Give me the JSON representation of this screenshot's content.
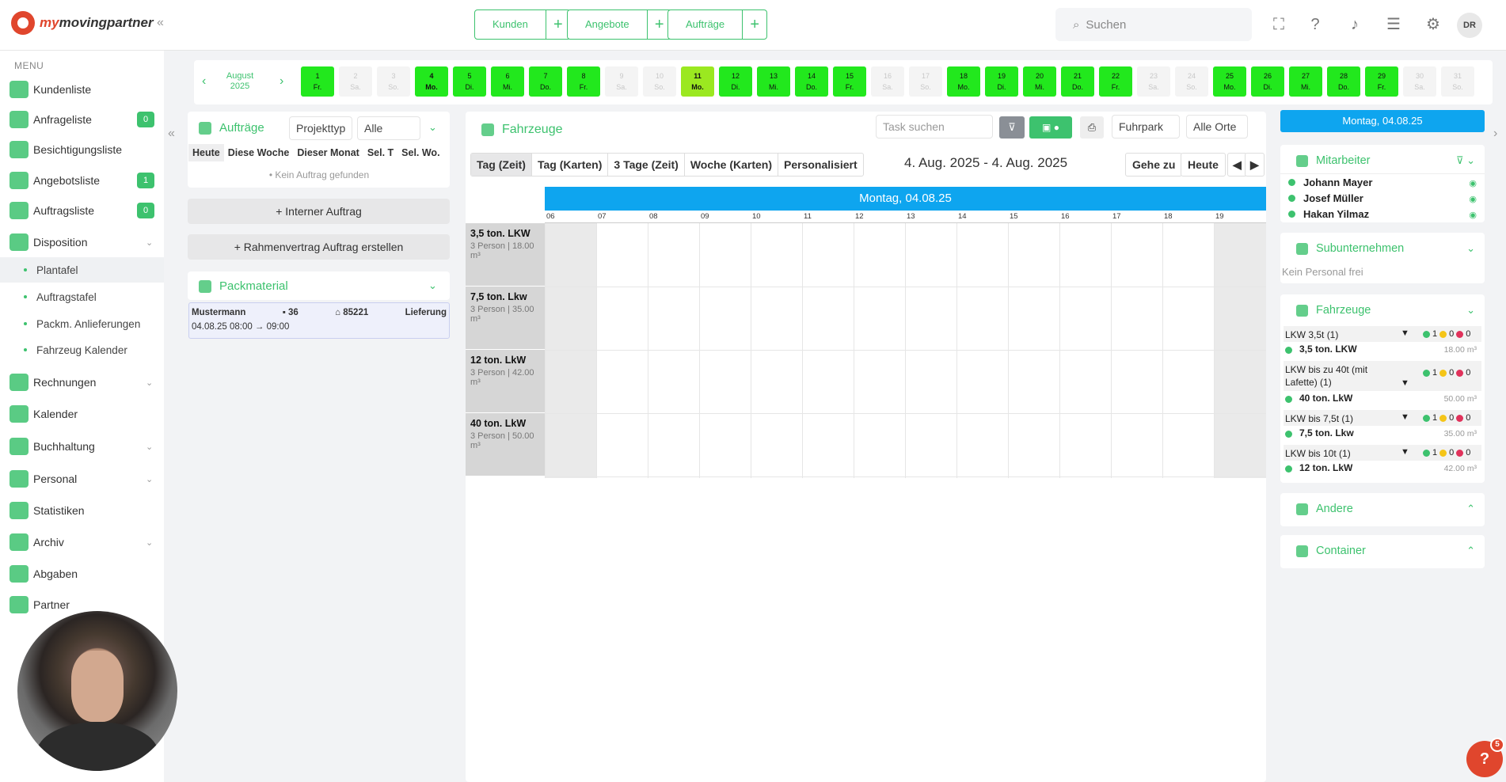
{
  "app": {
    "logo_text_1": "my",
    "logo_text_2": "movingpartner"
  },
  "topbar": {
    "quick": [
      {
        "label": "Kunden"
      },
      {
        "label": "Angebote"
      },
      {
        "label": "Aufträge"
      }
    ],
    "search_placeholder": "Suchen",
    "avatar": "DR"
  },
  "sidebar": {
    "menu_label": "MENU",
    "items": [
      {
        "label": "Kundenliste"
      },
      {
        "label": "Anfrageliste",
        "badge": "0"
      },
      {
        "label": "Besichtigungsliste"
      },
      {
        "label": "Angebotsliste",
        "badge": "1"
      },
      {
        "label": "Auftragsliste",
        "badge": "0"
      },
      {
        "label": "Disposition"
      },
      {
        "label": "Rechnungen"
      },
      {
        "label": "Kalender"
      },
      {
        "label": "Buchhaltung"
      },
      {
        "label": "Personal"
      },
      {
        "label": "Statistiken"
      },
      {
        "label": "Archiv"
      },
      {
        "label": "Abgaben"
      },
      {
        "label": "Partner"
      }
    ],
    "sub": [
      {
        "label": "Plantafel"
      },
      {
        "label": "Auftragstafel"
      },
      {
        "label": "Packm. Anlieferungen"
      },
      {
        "label": "Fahrzeug Kalender"
      }
    ]
  },
  "datebar": {
    "month": "August",
    "year": "2025",
    "days": [
      {
        "n": "1",
        "d": "Fr."
      },
      {
        "n": "2",
        "d": "Sa."
      },
      {
        "n": "3",
        "d": "So."
      },
      {
        "n": "4",
        "d": "Mo."
      },
      {
        "n": "5",
        "d": "Di."
      },
      {
        "n": "6",
        "d": "Mi."
      },
      {
        "n": "7",
        "d": "Do."
      },
      {
        "n": "8",
        "d": "Fr."
      },
      {
        "n": "9",
        "d": "Sa."
      },
      {
        "n": "10",
        "d": "So."
      },
      {
        "n": "11",
        "d": "Mo."
      },
      {
        "n": "12",
        "d": "Di."
      },
      {
        "n": "13",
        "d": "Mi."
      },
      {
        "n": "14",
        "d": "Do."
      },
      {
        "n": "15",
        "d": "Fr."
      },
      {
        "n": "16",
        "d": "Sa."
      },
      {
        "n": "17",
        "d": "So."
      },
      {
        "n": "18",
        "d": "Mo."
      },
      {
        "n": "19",
        "d": "Di."
      },
      {
        "n": "20",
        "d": "Mi."
      },
      {
        "n": "21",
        "d": "Do."
      },
      {
        "n": "22",
        "d": "Fr."
      },
      {
        "n": "23",
        "d": "Sa."
      },
      {
        "n": "24",
        "d": "So."
      },
      {
        "n": "25",
        "d": "Mo."
      },
      {
        "n": "26",
        "d": "Di."
      },
      {
        "n": "27",
        "d": "Mi."
      },
      {
        "n": "28",
        "d": "Do."
      },
      {
        "n": "29",
        "d": "Fr."
      },
      {
        "n": "30",
        "d": "Sa."
      },
      {
        "n": "31",
        "d": "So."
      }
    ]
  },
  "auftraege": {
    "title": "Aufträge",
    "projekttyp": "Projekttyp",
    "filter": "Alle",
    "tabs": [
      "Heute",
      "Diese Woche",
      "Dieser Monat",
      "Sel. T",
      "Sel. Wo."
    ],
    "empty": "• Kein Auftrag gefunden",
    "btn_intern": "+ Interner Auftrag",
    "btn_rahmen": "+ Rahmenvertrag Auftrag erstellen"
  },
  "packmaterial": {
    "title": "Packmaterial",
    "card": {
      "name": "Mustermann",
      "qty": "36",
      "zip": "85221",
      "type": "Lieferung",
      "time": "04.08.25 08:00 → 09:00"
    }
  },
  "fahrzeuge": {
    "title": "Fahrzeuge",
    "task_placeholder": "Task suchen",
    "fuhrpark": "Fuhrpark",
    "orte": "Alle Orte",
    "views": [
      "Tag (Zeit)",
      "Tag (Karten)",
      "3 Tage (Zeit)",
      "Woche (Karten)",
      "Personalisiert"
    ],
    "range": "4. Aug. 2025 - 4. Aug. 2025",
    "goto": "Gehe zu",
    "today": "Heute",
    "day_header": "Montag, 04.08.25",
    "hours": [
      "06",
      "07",
      "08",
      "09",
      "10",
      "11",
      "12",
      "13",
      "14",
      "15",
      "16",
      "17",
      "18",
      "19"
    ],
    "resources": [
      {
        "name": "3,5 ton. LKW",
        "info": "3 Person | 18.00 m³"
      },
      {
        "name": "7,5 ton. Lkw",
        "info": "3 Person | 35.00 m³"
      },
      {
        "name": "12 ton. LkW",
        "info": "3 Person | 42.00 m³"
      },
      {
        "name": "40 ton. LkW",
        "info": "3 Person | 50.00 m³"
      }
    ]
  },
  "right": {
    "date": "Montag, 04.08.25",
    "mitarbeiter_title": "Mitarbeiter",
    "mitarbeiter": [
      "Johann Mayer",
      "Josef Müller",
      "Hakan Yilmaz"
    ],
    "sub_title": "Subunternehmen",
    "sub_empty": "Kein Personal frei",
    "fz_title": "Fahrzeuge",
    "groups": [
      {
        "name": "LKW 3,5t (1)",
        "g": "1",
        "y": "0",
        "r": "0",
        "veh": "3,5 ton. LKW",
        "cap": "18.00 m³"
      },
      {
        "name": "LKW bis zu 40t (mit Lafette) (1)",
        "g": "1",
        "y": "0",
        "r": "0",
        "veh": "40 ton. LkW",
        "cap": "50.00 m³"
      },
      {
        "name": "LKW bis 7,5t (1)",
        "g": "1",
        "y": "0",
        "r": "0",
        "veh": "7,5 ton. Lkw",
        "cap": "35.00 m³"
      },
      {
        "name": "LKW bis 10t (1)",
        "g": "1",
        "y": "0",
        "r": "0",
        "veh": "12 ton. LkW",
        "cap": "42.00 m³"
      }
    ],
    "andere": "Andere",
    "container": "Container"
  },
  "help_badge": "5",
  "colors": {
    "accent": "#3dc26e",
    "blue": "#0ea5ef",
    "brand": "#e0462d"
  }
}
